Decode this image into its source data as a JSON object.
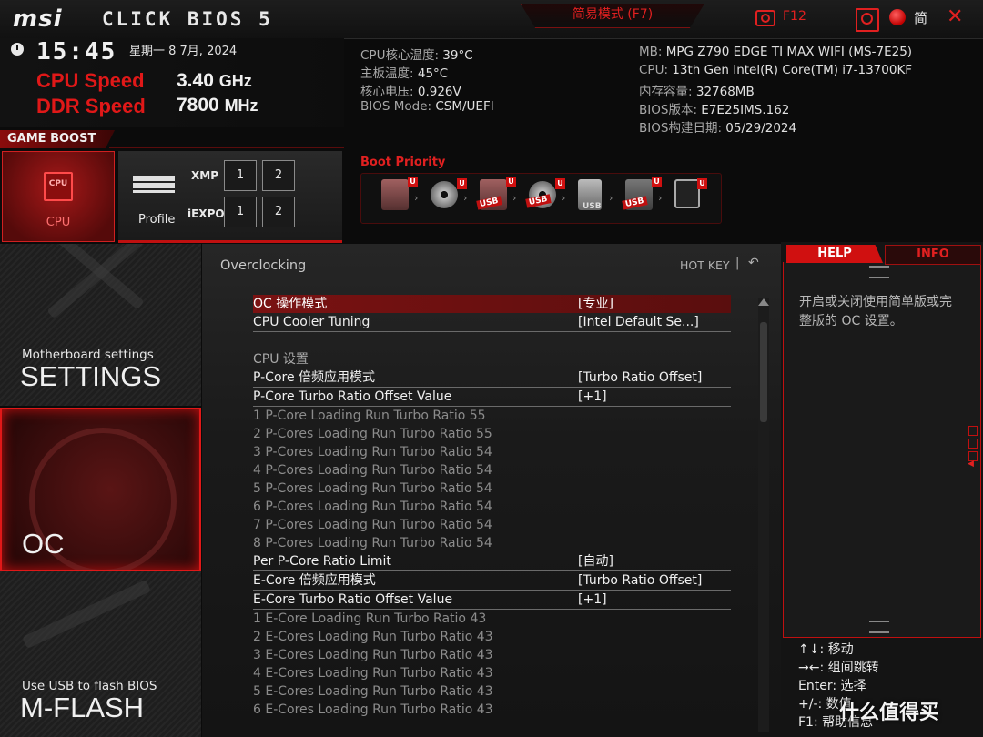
{
  "header": {
    "logo": "msi",
    "bios_title": "CLICK BIOS 5",
    "mode_button": "简易模式 (F7)",
    "screenshot_label": "F12",
    "language": "简",
    "close": "✕"
  },
  "status": {
    "time": "15:45",
    "date": "星期一  8 7月, 2024",
    "cpu_speed_label": "CPU Speed",
    "cpu_speed_value": "3.40",
    "cpu_speed_unit": "GHz",
    "ddr_speed_label": "DDR Speed",
    "ddr_speed_value": "7800",
    "ddr_speed_unit": "MHz"
  },
  "sysinfo": {
    "left": [
      {
        "label": "CPU核心温度:",
        "value": "39°C"
      },
      {
        "label": "主板温度:",
        "value": "45°C"
      },
      {
        "label": "核心电压:",
        "value": "0.926V"
      },
      {
        "label": "BIOS Mode:",
        "value": "CSM/UEFI"
      }
    ],
    "right": [
      {
        "label": "MB:",
        "value": "MPG Z790 EDGE TI MAX WIFI (MS-7E25)"
      },
      {
        "label": "CPU:",
        "value": "13th Gen Intel(R) Core(TM) i7-13700KF"
      },
      {
        "label": "内存容量:",
        "value": "32768MB"
      },
      {
        "label": "BIOS版本:",
        "value": "E7E25IMS.162"
      },
      {
        "label": "BIOS构建日期:",
        "value": "05/29/2024"
      }
    ]
  },
  "game_boost": {
    "label": "GAME BOOST",
    "cpu_chip": "CPU",
    "cpu_label": "CPU",
    "profile_label": "Profile",
    "xmp_label": "XMP",
    "iexpo_label": "iEXPO",
    "buttons": [
      "1",
      "2"
    ]
  },
  "boot_priority": {
    "title": "Boot Priority",
    "devices": [
      {
        "icon": "hdd-icon",
        "tag": ""
      },
      {
        "icon": "disc-icon",
        "tag": ""
      },
      {
        "icon": "usb-hdd-icon",
        "tag": "USB"
      },
      {
        "icon": "usb-disc-icon",
        "tag": "USB"
      },
      {
        "icon": "usb-key-icon",
        "tag": "USB"
      },
      {
        "icon": "usb-floppy-icon",
        "tag": "USB"
      },
      {
        "icon": "network-icon",
        "tag": ""
      }
    ],
    "badge": "U"
  },
  "nav": {
    "settings_small": "Motherboard settings",
    "settings_big": "SETTINGS",
    "oc_big": "OC",
    "mflash_small": "Use USB to flash BIOS",
    "mflash_big": "M-FLASH"
  },
  "main": {
    "section_title": "Overclocking",
    "hotkey": "HOT KEY",
    "separator": "|",
    "back": "↶",
    "items": [
      {
        "label": "OC 操作模式",
        "value": "[专业]",
        "state": "sel"
      },
      {
        "label": "CPU Cooler Tuning",
        "value": "[Intel Default Se...]",
        "state": "norm"
      },
      {
        "label": "",
        "value": "",
        "state": "spacer"
      },
      {
        "label": "CPU  设置",
        "value": "",
        "state": "head"
      },
      {
        "label": "P-Core 倍频应用模式",
        "value": "[Turbo Ratio Offset]",
        "state": "norm"
      },
      {
        "label": "P-Core Turbo Ratio Offset Value",
        "value": "[+1]",
        "state": "norm"
      },
      {
        "label": "1 P-Core Loading Run Turbo Ratio 55",
        "value": "",
        "state": "dis"
      },
      {
        "label": "2 P-Cores Loading Run Turbo Ratio 55",
        "value": "",
        "state": "dis"
      },
      {
        "label": "3 P-Cores Loading Run Turbo Ratio 54",
        "value": "",
        "state": "dis"
      },
      {
        "label": "4 P-Cores Loading Run Turbo Ratio 54",
        "value": "",
        "state": "dis"
      },
      {
        "label": "5 P-Cores Loading Run Turbo Ratio 54",
        "value": "",
        "state": "dis"
      },
      {
        "label": "6 P-Cores Loading Run Turbo Ratio 54",
        "value": "",
        "state": "dis"
      },
      {
        "label": "7 P-Cores Loading Run Turbo Ratio 54",
        "value": "",
        "state": "dis"
      },
      {
        "label": "8 P-Cores Loading Run Turbo Ratio 54",
        "value": "",
        "state": "dis"
      },
      {
        "label": "Per P-Core Ratio Limit",
        "value": "[自动]",
        "state": "norm"
      },
      {
        "label": "E-Core 倍频应用模式",
        "value": "[Turbo Ratio Offset]",
        "state": "norm"
      },
      {
        "label": "E-Core Turbo Ratio Offset Value",
        "value": "[+1]",
        "state": "norm"
      },
      {
        "label": "1 E-Core Loading Run Turbo Ratio 43",
        "value": "",
        "state": "dis"
      },
      {
        "label": "2 E-Cores Loading Run Turbo Ratio 43",
        "value": "",
        "state": "dis"
      },
      {
        "label": "3 E-Cores Loading Run Turbo Ratio 43",
        "value": "",
        "state": "dis"
      },
      {
        "label": "4 E-Cores Loading Run Turbo Ratio 43",
        "value": "",
        "state": "dis"
      },
      {
        "label": "5 E-Cores Loading Run Turbo Ratio 43",
        "value": "",
        "state": "dis"
      },
      {
        "label": "6 E-Cores Loading Run Turbo Ratio 43",
        "value": "",
        "state": "dis"
      }
    ]
  },
  "help": {
    "tab_help": "HELP",
    "tab_info": "INFO",
    "text": "开启或关闭使用简单版或完整版的 OC 设置。",
    "keys": [
      {
        "key": "↑↓:",
        "desc": "移动"
      },
      {
        "key": "→←:",
        "desc": "组间跳转"
      },
      {
        "key": "Enter:",
        "desc": "选择"
      },
      {
        "key": "+/-:",
        "desc": "数值"
      },
      {
        "key": "F1:",
        "desc": "帮助信息"
      }
    ]
  },
  "watermark": "什么值得买",
  "colors": {
    "accent": "#e02020",
    "selected_row": "#7a1212",
    "panel_bg": "#141414"
  }
}
